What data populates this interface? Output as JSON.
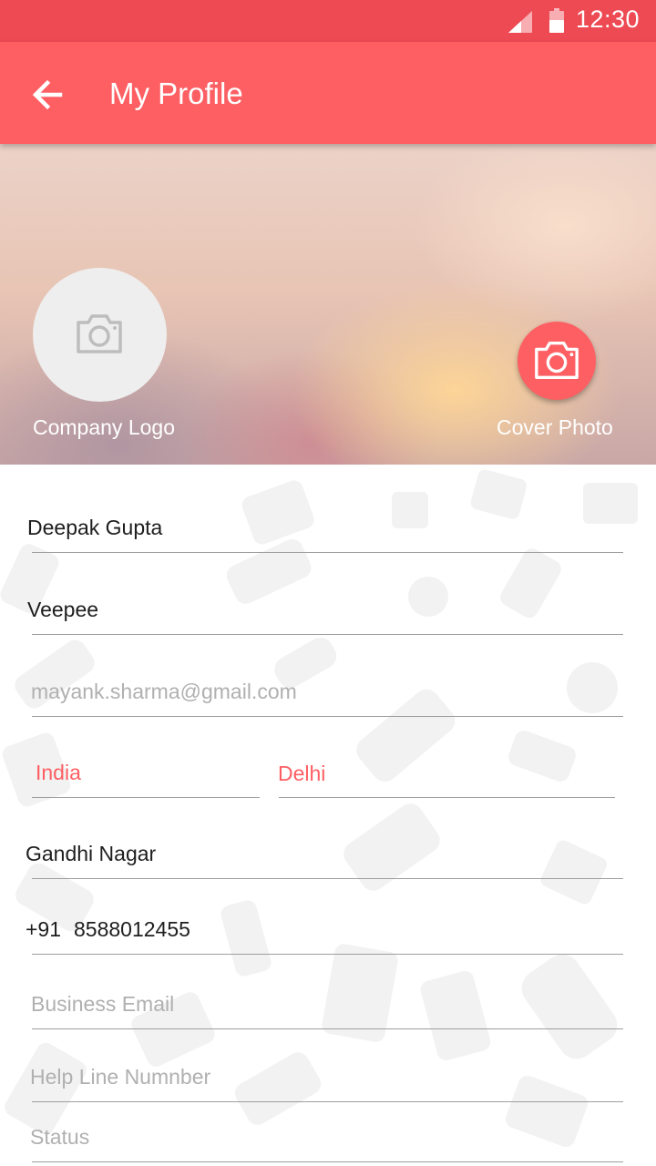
{
  "status_bar": {
    "time": "12:30"
  },
  "app_bar": {
    "title": "My Profile",
    "back_icon": "arrow-left-icon"
  },
  "cover": {
    "company_logo_label": "Company Logo",
    "cover_photo_label": "Cover Photo",
    "camera_icon": "camera-icon"
  },
  "form": {
    "name": "Deepak Gupta",
    "company": "Veepee",
    "email_placeholder": "mayank.sharma@gmail.com",
    "country": "India",
    "city": "Delhi",
    "locality": "Gandhi Nagar",
    "country_code": "+91",
    "phone": "8588012455",
    "business_email_placeholder": "Business Email",
    "helpline_placeholder": "Help Line Numnber",
    "status_placeholder": "Status"
  },
  "colors": {
    "primary": "#fe5f63",
    "status_bar": "#ee4a53",
    "logo_circle": "#eeeeee",
    "hint": "#b0b0b0",
    "divider": "#9e9e9e"
  }
}
